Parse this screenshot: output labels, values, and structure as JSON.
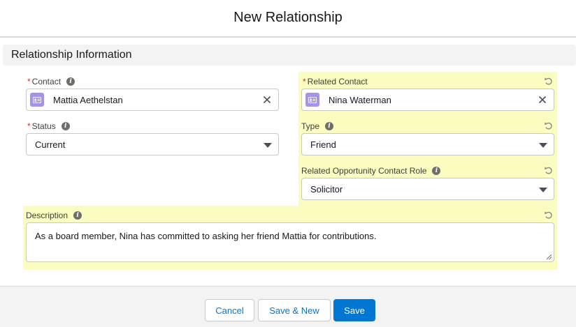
{
  "modal": {
    "title": "New Relationship"
  },
  "section": {
    "title": "Relationship Information"
  },
  "fields": {
    "contact": {
      "label": "Contact",
      "required_mark": "*",
      "value": "Mattia Aethelstan",
      "icon": "contact-card-icon"
    },
    "related_contact": {
      "label": "Related Contact",
      "required_mark": "*",
      "value": "Nina Waterman",
      "icon": "contact-card-icon"
    },
    "status": {
      "label": "Status",
      "required_mark": "*",
      "value": "Current"
    },
    "type": {
      "label": "Type",
      "value": "Friend"
    },
    "related_opportunity_contact_role": {
      "label": "Related Opportunity Contact Role",
      "value": "Solicitor"
    },
    "description": {
      "label": "Description",
      "value": "As a board member, Nina has committed to asking her friend Mattia for contributions."
    }
  },
  "footer": {
    "cancel_label": "Cancel",
    "save_new_label": "Save & New",
    "save_label": "Save"
  },
  "colors": {
    "brand": "#0176d3",
    "highlight": "#fbfcbf",
    "required": "#c23934",
    "contact_icon_bg": "#a094ed"
  }
}
